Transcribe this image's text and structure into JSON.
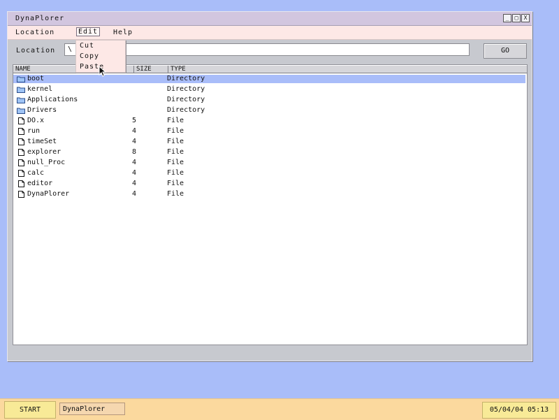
{
  "window": {
    "title": "DynaPlorer",
    "controls": [
      "_",
      "□",
      "X"
    ]
  },
  "menubar": {
    "location": "Location",
    "edit": "Edit",
    "help": "Help"
  },
  "location_bar": {
    "label": "Location",
    "value": "\\",
    "go": "GO"
  },
  "columns": {
    "name": "NAME",
    "size": "SIZE",
    "type": "TYPE"
  },
  "files": [
    {
      "name": "boot",
      "size": "",
      "type": "Directory",
      "icon": "folder-icon",
      "selected": true
    },
    {
      "name": "kernel",
      "size": "",
      "type": "Directory",
      "icon": "folder-icon"
    },
    {
      "name": "Applications",
      "size": "",
      "type": "Directory",
      "icon": "folder-icon"
    },
    {
      "name": "Drivers",
      "size": "",
      "type": "Directory",
      "icon": "folder-icon"
    },
    {
      "name": "DO.x",
      "size": "5",
      "type": "File",
      "icon": "file-icon"
    },
    {
      "name": "run",
      "size": "4",
      "type": "File",
      "icon": "file-icon"
    },
    {
      "name": "timeSet",
      "size": "4",
      "type": "File",
      "icon": "file-icon"
    },
    {
      "name": "explorer",
      "size": "8",
      "type": "File",
      "icon": "file-icon"
    },
    {
      "name": "null_Proc",
      "size": "4",
      "type": "File",
      "icon": "file-icon"
    },
    {
      "name": "calc",
      "size": "4",
      "type": "File",
      "icon": "file-icon"
    },
    {
      "name": "editor",
      "size": "4",
      "type": "File",
      "icon": "file-icon"
    },
    {
      "name": "DynaPlorer",
      "size": "4",
      "type": "File",
      "icon": "file-icon"
    }
  ],
  "edit_menu": [
    "Cut",
    "Copy",
    "Paste"
  ],
  "taskbar": {
    "start": "START",
    "task": "DynaPlorer",
    "clock": "05/04/04 05:13"
  },
  "colors": {
    "desktop": "#a9bdf9",
    "titlebar": "#d2c6df",
    "menubar": "#fde8e6",
    "selection": "#a9bdf9",
    "taskbar": "#fbd99e"
  }
}
